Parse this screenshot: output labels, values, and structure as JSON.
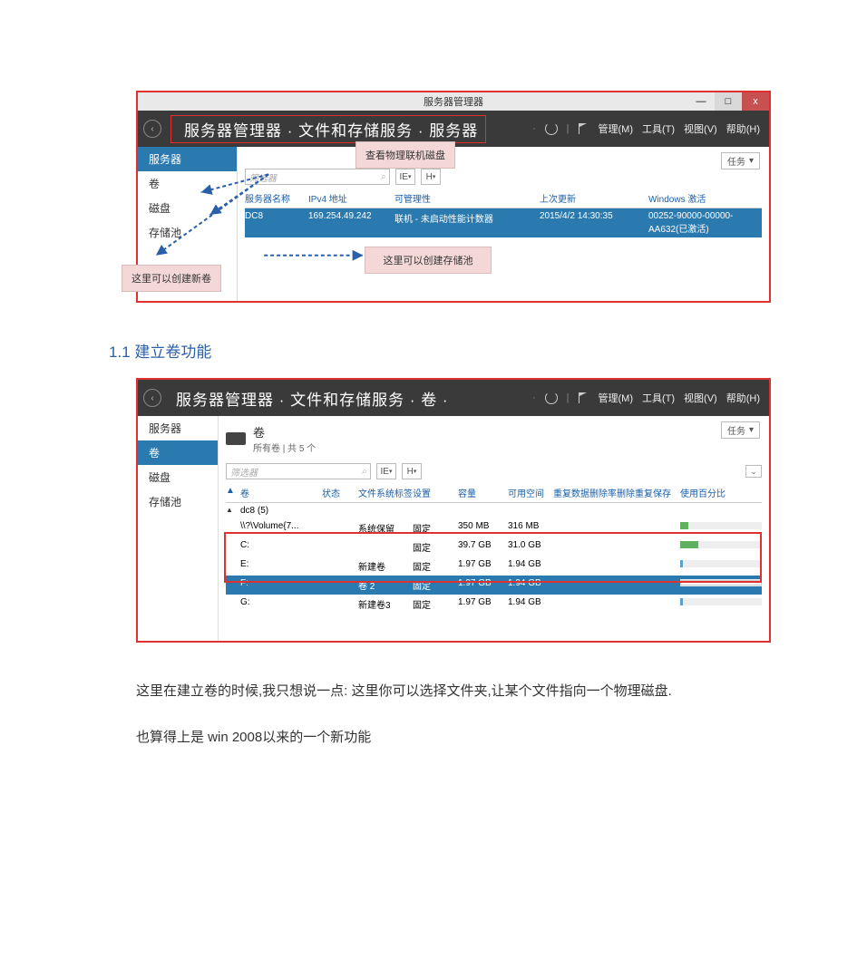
{
  "shot1": {
    "window_title": "服务器管理器",
    "window_btns": {
      "min": "—",
      "max": "□",
      "close": "x"
    },
    "nav_back": "‹",
    "breadcrumb": "服务器管理器 · 文件和存储服务 · 服务器",
    "menu": {
      "refresh_sep": "·",
      "manage": "管理(M)",
      "tools": "工具(T)",
      "view": "视图(V)",
      "help": "帮助(H)"
    },
    "sidebar": {
      "items": [
        "服务器",
        "卷",
        "磁盘",
        "存储池"
      ],
      "active_index": 0
    },
    "tasks": "任务",
    "search_placeholder": "筛选器",
    "search_icon": "⌕",
    "filter_ie": "IE",
    "filter_h": "H",
    "head": {
      "name": "服务器名称",
      "ip": "IPv4 地址",
      "manage": "可管理性",
      "update": "上次更新",
      "activate": "Windows 激活"
    },
    "row": {
      "name": "DC8",
      "ip": "169.254.49.242",
      "manage": "联机 - 未启动性能计数器",
      "update": "2015/4/2 14:30:35",
      "activate": "00252-90000-00000-AA632(已激活)"
    },
    "callouts": {
      "view_disk": "查看物理联机磁盘",
      "new_volume": "这里可以创建新卷",
      "new_pool": "这里可以创建存储池"
    }
  },
  "section_1_1": "1.1 建立卷功能",
  "shot2": {
    "nav_back": "‹",
    "breadcrumb": "服务器管理器 · 文件和存储服务 · 卷 ·",
    "menu": {
      "manage": "管理(M)",
      "tools": "工具(T)",
      "view": "视图(V)",
      "help": "帮助(H)"
    },
    "sidebar": {
      "items": [
        "服务器",
        "卷",
        "磁盘",
        "存储池"
      ],
      "active_index": 1
    },
    "panel": {
      "title": "卷",
      "subtitle": "所有卷 | 共 5 个"
    },
    "tasks": "任务",
    "search_placeholder": "筛选器",
    "search_icon": "⌕",
    "filter_ie": "IE",
    "filter_h": "H",
    "expand": "⌄",
    "head": {
      "flag": "▲",
      "vol": "卷",
      "status": "状态",
      "fslabel": "文件系统标签",
      "device": "设置",
      "cap": "容量",
      "free": "可用空间",
      "dedup": "重复数据删除率",
      "dedup_save": "删除重复保存",
      "usage": "使用百分比"
    },
    "group": {
      "tri": "▲",
      "label": "dc8 (5)"
    },
    "rows": [
      {
        "vol": "\\\\?\\Volume{7...",
        "fslabel": "系统保留",
        "device": "固定",
        "cap": "350 MB",
        "free": "316 MB",
        "usage_pct": 10,
        "bar": "green"
      },
      {
        "vol": "C:",
        "fslabel": "",
        "device": "固定",
        "cap": "39.7 GB",
        "free": "31.0 GB",
        "usage_pct": 22,
        "bar": "green"
      },
      {
        "vol": "E:",
        "fslabel": "新建卷",
        "device": "固定",
        "cap": "1.97 GB",
        "free": "1.94 GB",
        "usage_pct": 3,
        "bar": "blue"
      },
      {
        "vol": "F:",
        "fslabel": "卷 2",
        "device": "固定",
        "cap": "1.97 GB",
        "free": "1.94 GB",
        "usage_pct": 3,
        "bar": "white",
        "selected": true
      },
      {
        "vol": "G:",
        "fslabel": "新建卷3",
        "device": "固定",
        "cap": "1.97 GB",
        "free": "1.94 GB",
        "usage_pct": 3,
        "bar": "blue"
      }
    ]
  },
  "para1": "这里在建立卷的时候,我只想说一点: 这里你可以选择文件夹,让某个文件指向一个物理磁盘.",
  "para2": "也算得上是 win  2008以来的一个新功能"
}
